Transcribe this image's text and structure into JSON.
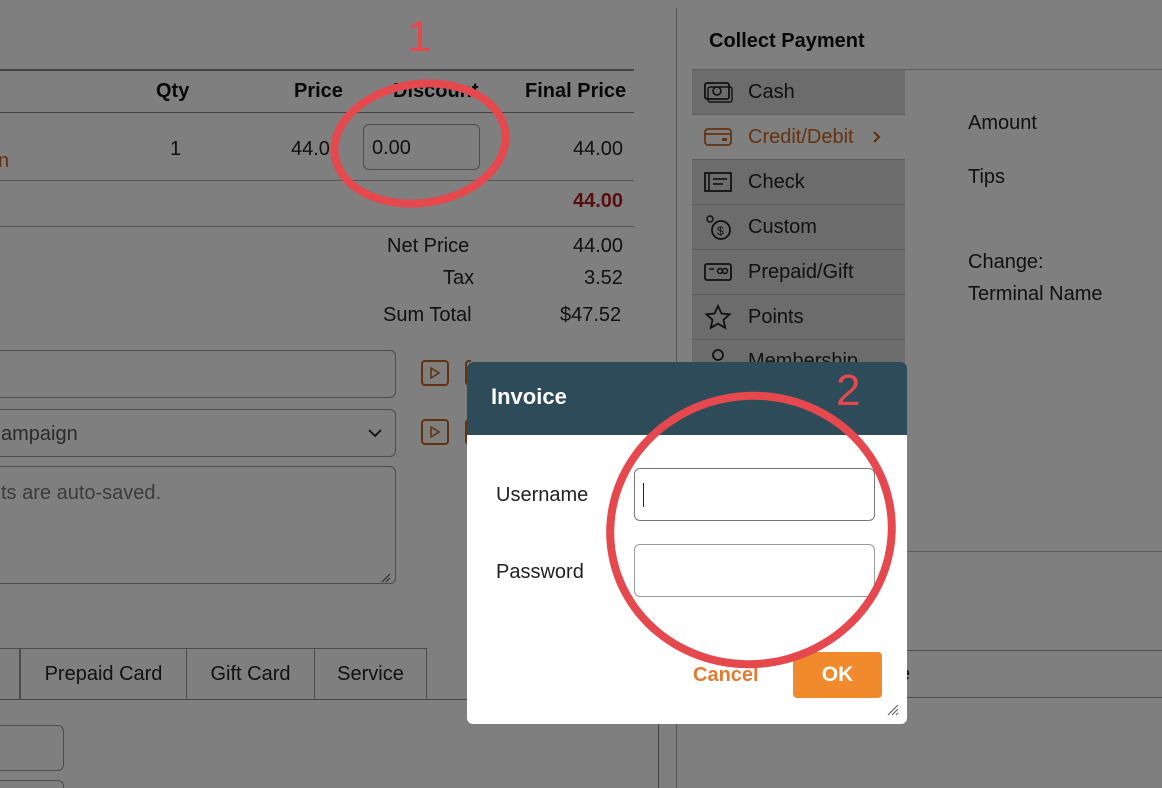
{
  "order_table": {
    "headers": {
      "qty": "Qty",
      "price": "Price",
      "discount": "Discount",
      "final_price": "Final Price"
    },
    "row": {
      "item_fragment": "n",
      "qty": "1",
      "price": "44.0",
      "discount_value": "0.00",
      "final_price": "44.00"
    },
    "subtotal": "44.00"
  },
  "totals": {
    "net_price_label": "Net Price",
    "net_price_value": "44.00",
    "tax_label": "Tax",
    "tax_value": "3.52",
    "sum_total_label": "Sum Total",
    "sum_total_value": "$47.52"
  },
  "form": {
    "campaign_select_value": "ampaign",
    "notes_placeholder": "ts are auto-saved."
  },
  "bottom_tabs": [
    "Prepaid Card",
    "Gift Card",
    "Service"
  ],
  "collect_payment": {
    "title": "Collect Payment",
    "methods": [
      {
        "label": "Cash",
        "icon": "cash-icon",
        "active": false
      },
      {
        "label": "Credit/Debit",
        "icon": "credit-card-icon",
        "active": true
      },
      {
        "label": "Check",
        "icon": "check-icon",
        "active": false
      },
      {
        "label": "Custom",
        "icon": "custom-payment-icon",
        "active": false
      },
      {
        "label": "Prepaid/Gift",
        "icon": "gift-card-icon",
        "active": false
      },
      {
        "label": "Points",
        "icon": "star-icon",
        "active": false
      },
      {
        "label": "Membership",
        "icon": "membership-icon",
        "active": false
      }
    ],
    "amount_label": "Amount",
    "tips_label": "Tips",
    "change_label": "Change:",
    "terminal_label": "Terminal Name",
    "hidden_fragment": "e"
  },
  "modal": {
    "title": "Invoice",
    "username_label": "Username",
    "username_value": "",
    "password_label": "Password",
    "password_value": "",
    "cancel_label": "Cancel",
    "ok_label": "OK"
  },
  "annotations": [
    "1",
    "2"
  ],
  "colors": {
    "accent": "#c8651e",
    "modal_header": "#2e4b5a",
    "ok_button": "#f08a2c",
    "annotation": "#e5484d",
    "total_red": "#b01c1c"
  }
}
